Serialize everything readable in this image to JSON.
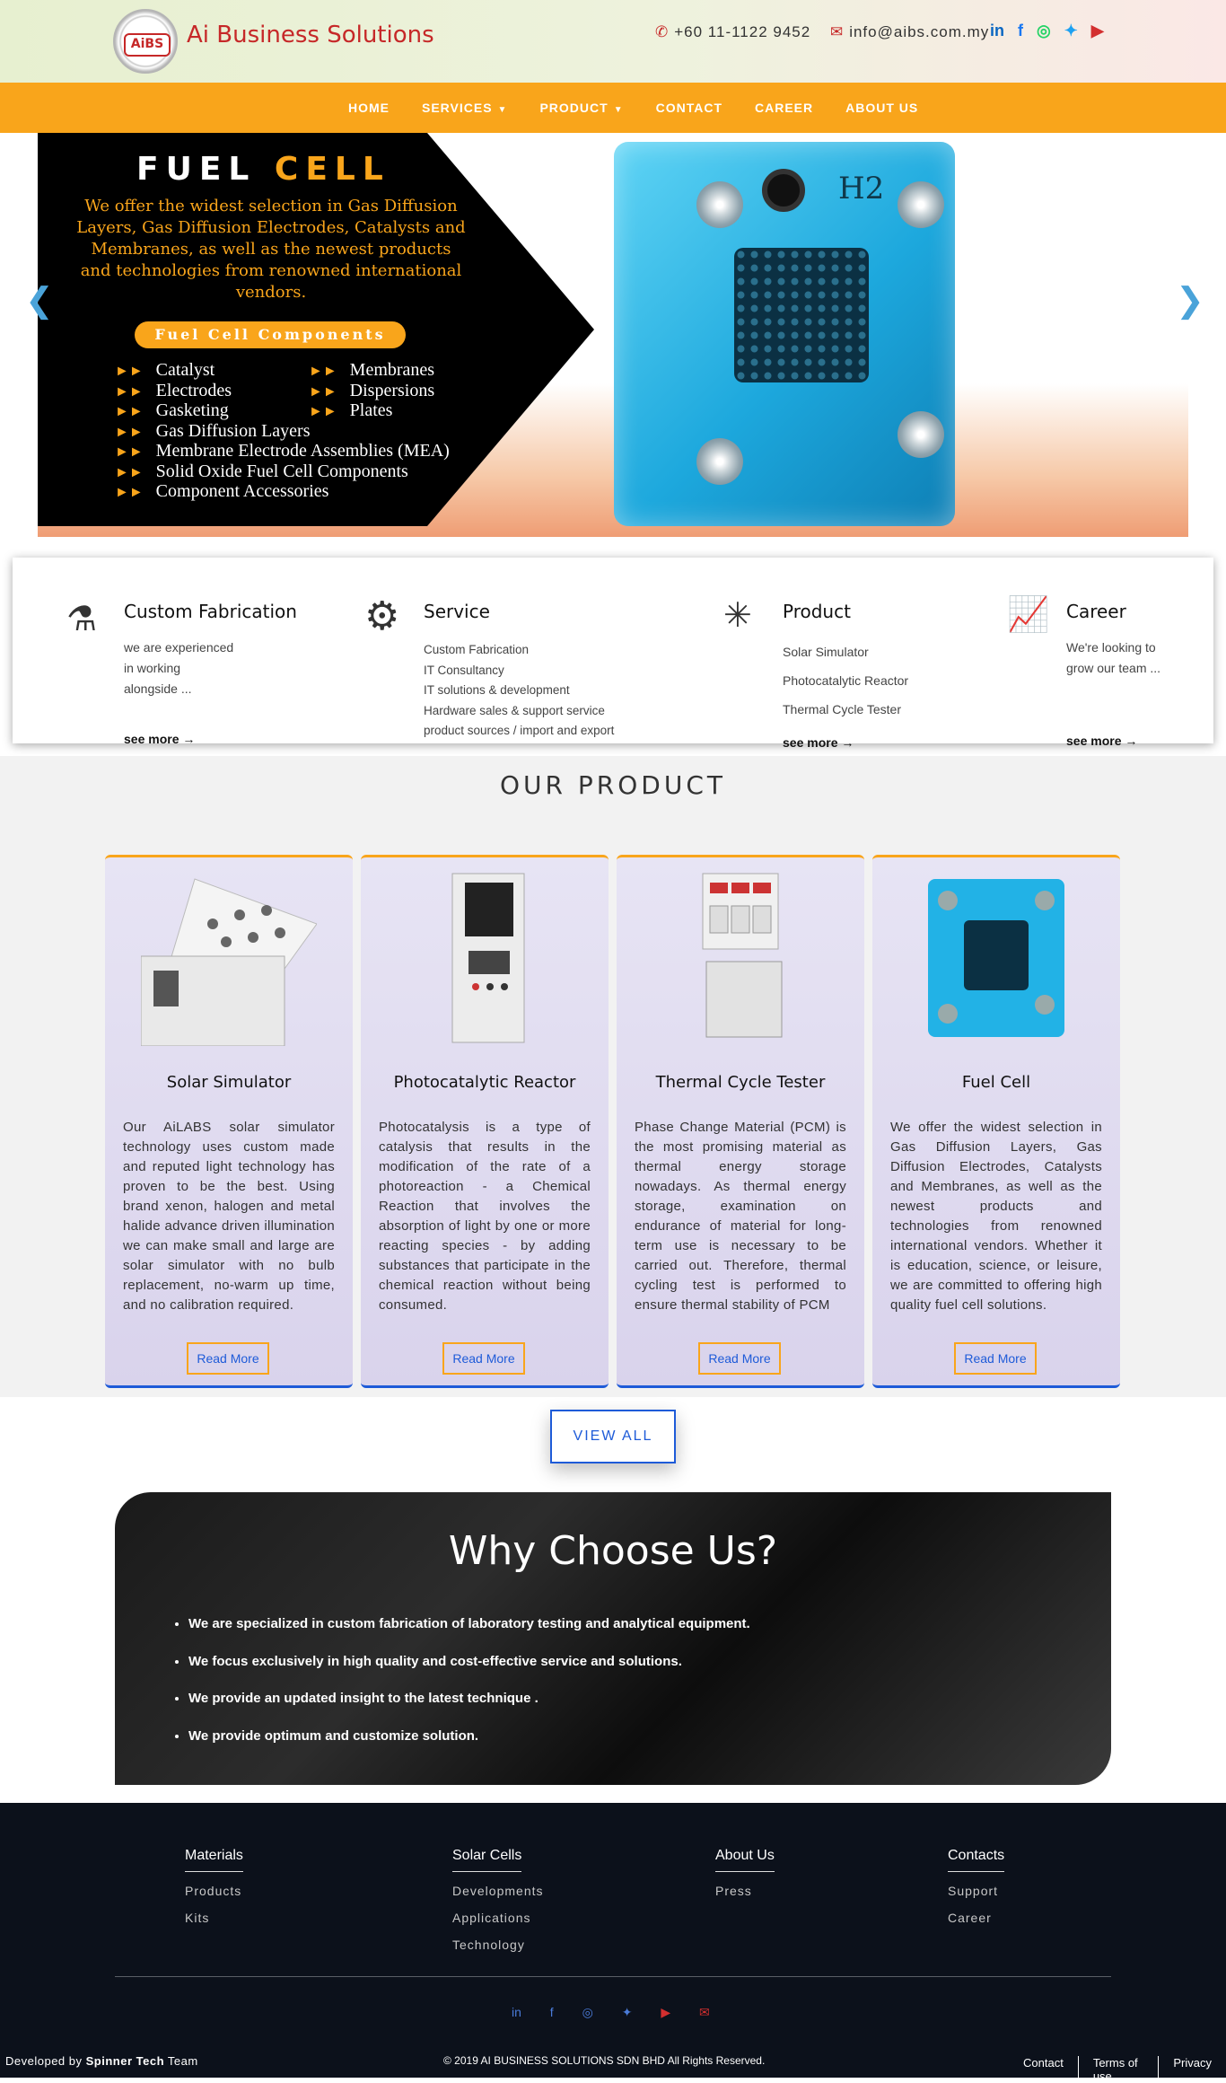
{
  "header": {
    "logo_text": "AiBS",
    "brand": "Ai Business Solutions",
    "phone": "+60 11-1122 9452",
    "email": "info@aibs.com.my",
    "social_icons": [
      "linkedin-icon",
      "facebook-icon",
      "whatsapp-icon",
      "twitter-icon",
      "youtube-icon"
    ]
  },
  "nav": {
    "items": [
      {
        "label": "HOME"
      },
      {
        "label": "SERVICES"
      },
      {
        "label": "PRODUCT"
      },
      {
        "label": "CONTACT"
      },
      {
        "label": "CAREER"
      },
      {
        "label": "ABOUT US"
      }
    ]
  },
  "hero": {
    "title_a": "FUEL",
    "title_b": "CELL",
    "description": "We offer the widest selection in Gas Diffusion Layers, Gas Diffusion Electrodes, Catalysts and Membranes, as well as the newest products and technologies from renowned international vendors.",
    "pill": "Fuel Cell Components",
    "list_left": [
      "Catalyst",
      "Electrodes",
      "Gasketing",
      "Gas Diffusion Layers",
      "Membrane Electrode Assemblies (MEA)",
      "Solid Oxide Fuel Cell Components",
      "Component Accessories"
    ],
    "list_right": [
      "Membranes",
      "Dispersions",
      "Plates"
    ],
    "device_label": "H2",
    "prev": "❮",
    "next": "❯"
  },
  "features": {
    "fabrication": {
      "title": "Custom Fabrication",
      "lines": [
        "we are experienced",
        "in working",
        "alongside ..."
      ],
      "more": "see more"
    },
    "service": {
      "title": "Service",
      "lines": [
        "Custom Fabrication",
        "IT Consultancy",
        "IT solutions & development",
        "Hardware sales & support service",
        "product sources / import and export"
      ]
    },
    "product": {
      "title": "Product",
      "lines": [
        "Solar Simulator",
        "Photocatalytic Reactor",
        "Thermal Cycle Tester"
      ],
      "more": "see more"
    },
    "career": {
      "title": "Career",
      "lines": [
        "We're looking to",
        "grow our team ..."
      ],
      "more": "see more"
    }
  },
  "products": {
    "title": "OUR  PRODUCT",
    "cards": [
      {
        "name": "Solar Simulator",
        "text": "Our AiLABS solar simulator technology uses custom made and reputed light technology has proven to be the best. Using brand xenon, halogen and metal halide advance driven illumination we can make small and large are solar simulator with no bulb replacement, no-warm up time, and no calibration required.",
        "button": "Read More"
      },
      {
        "name": "Photocatalytic Reactor",
        "text": "Photocatalysis is a type of catalysis that results in the modification of the rate of a photoreaction - a Chemical Reaction that involves the absorption of light by one or more reacting species - by adding substances that participate in the chemical reaction without being consumed.",
        "button": "Read More"
      },
      {
        "name": "Thermal Cycle Tester",
        "text": "Phase Change Material (PCM) is the most promising material as thermal energy storage nowadays. As thermal energy storage, examination on endurance of material for long-term use is necessary to be carried out. Therefore, thermal cycling test is performed to ensure thermal stability of PCM",
        "button": "Read More"
      },
      {
        "name": "Fuel Cell",
        "text": "We offer the widest selection in Gas Diffusion Layers, Gas Diffusion Electrodes, Catalysts and Membranes, as well as the newest products and technologies from renowned international vendors. Whether it is education, science, or leisure, we are committed to offering high quality fuel cell solutions.",
        "button": "Read More"
      }
    ],
    "view_all": "VIEW ALL"
  },
  "why": {
    "title": "Why Choose Us?",
    "items": [
      "We are specialized in custom fabrication of laboratory testing and analytical equipment.",
      "We focus exclusively in high quality and cost-effective service and solutions.",
      "We provide an updated insight to the latest technique .",
      "We provide optimum and customize solution."
    ]
  },
  "footer": {
    "cols": [
      {
        "head": "Materials",
        "links": [
          "Products",
          "Kits"
        ]
      },
      {
        "head": "Solar Cells",
        "links": [
          "Developments",
          "Applications",
          "Technology"
        ]
      },
      {
        "head": "About Us",
        "links": [
          "Press"
        ]
      },
      {
        "head": "Contacts",
        "links": [
          "Support",
          "Career"
        ]
      }
    ],
    "developed_prefix": "Developed by",
    "developer": "Spinner Tech",
    "developed_suffix": "Team",
    "copyright": "© 2019 AI BUSINESS SOLUTIONS SDN BHD All Rights Reserved.",
    "links": [
      "Contact",
      "Terms of use",
      "Privacy"
    ]
  }
}
